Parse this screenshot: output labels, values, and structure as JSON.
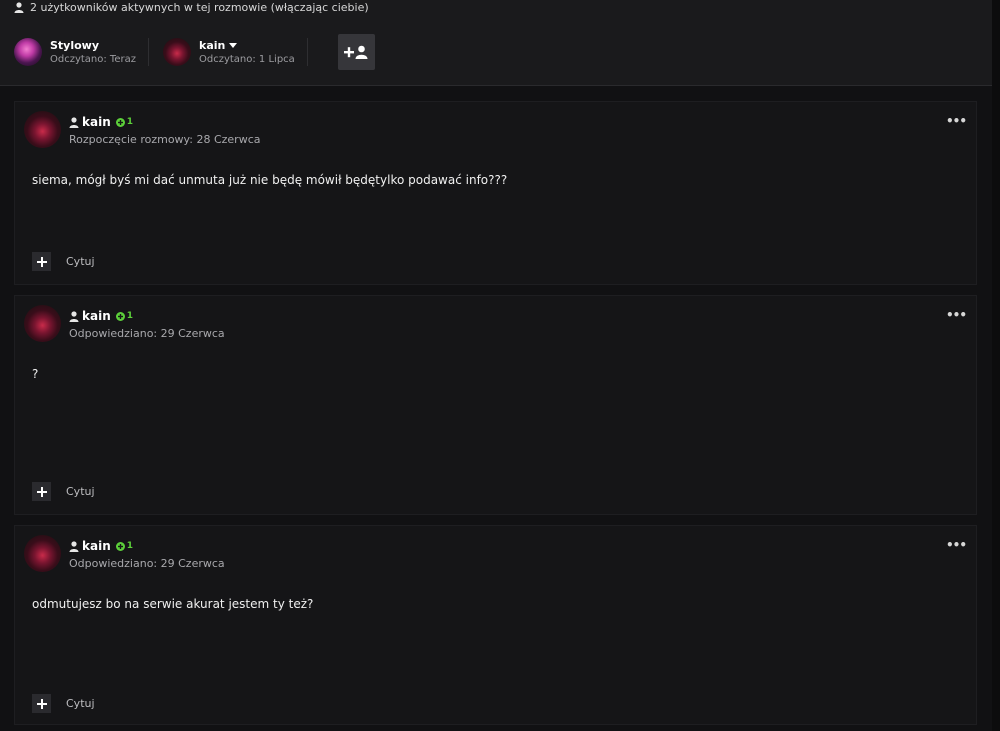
{
  "active_users_text": "2 użytkowników aktywnych w tej rozmowie (włączając ciebie)",
  "participants": [
    {
      "name": "Stylowy",
      "seen": "Odczytano: Teraz",
      "has_dropdown": false
    },
    {
      "name": "kain",
      "seen": "Odczytano: 1 Lipca",
      "has_dropdown": true
    }
  ],
  "add_participant_icon": "add-user-icon",
  "posts": [
    {
      "author": "kain",
      "reputation": "1",
      "date": "Rozpoczęcie rozmowy: 28 Czerwca",
      "body": "siema, mógł byś mi dać unmuta już nie będę mówił będętylko podawać info???",
      "quote_label": "Cytuj"
    },
    {
      "author": "kain",
      "reputation": "1",
      "date": "Odpowiedziano: 29 Czerwca",
      "body": "?",
      "quote_label": "Cytuj"
    },
    {
      "author": "kain",
      "reputation": "1",
      "date": "Odpowiedziano: 29 Czerwca",
      "body": "odmutujesz bo na serwie akurat jestem ty też?",
      "quote_label": "Cytuj"
    }
  ],
  "colors": {
    "background": "#111113",
    "post_background": "#151517",
    "reputation_green": "#5ccf3a"
  }
}
